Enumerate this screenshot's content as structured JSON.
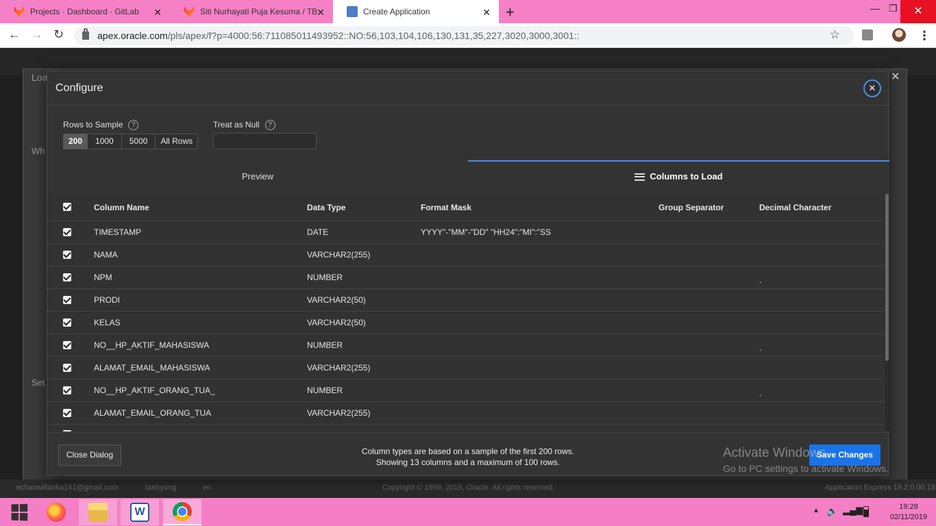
{
  "browser": {
    "tabs": [
      {
        "title": "Projects · Dashboard · GitLab"
      },
      {
        "title": "Siti Nurhayati Puja Kesuma / TB D"
      },
      {
        "title": "Create Application"
      }
    ],
    "url_host": "apex.oracle.com",
    "url_path": "/pls/apex/f?p=4000:56:711085011493952::NO:56,103,104,106,130,131,35,227,3020,3000,3001::"
  },
  "background": {
    "dialog_title_partial": "Loa",
    "section1_partial": "Wh",
    "section2_partial": "Set",
    "footer_email": "echaowillanka141@gmail.com",
    "footer_user": "taehyung",
    "footer_lang": "en",
    "footer_copyright": "Copyright © 1999, 2019, Oracle. All rights reserved.",
    "footer_version": "Application Express 19.2.0.00.18"
  },
  "dialog": {
    "title": "Configure",
    "rows_to_sample_label": "Rows to Sample",
    "rows_options": [
      "200",
      "1000",
      "5000",
      "All Rows"
    ],
    "rows_selected": "200",
    "treat_as_null_label": "Treat as Null",
    "treat_as_null_value": "",
    "tabs": {
      "preview": "Preview",
      "columns": "Columns to Load"
    },
    "headers": {
      "column_name": "Column Name",
      "data_type": "Data Type",
      "format_mask": "Format Mask",
      "group_separator": "Group Separator",
      "decimal_character": "Decimal Character"
    },
    "rows": [
      {
        "name": "TIMESTAMP",
        "type": "DATE",
        "mask": "YYYY\"-\"MM\"-\"DD\" \"HH24\":\"MI\":\"SS",
        "group": "",
        "decimal": ""
      },
      {
        "name": "NAMA",
        "type": "VARCHAR2(255)",
        "mask": "",
        "group": "",
        "decimal": ""
      },
      {
        "name": "NPM",
        "type": "NUMBER",
        "mask": "",
        "group": "",
        "decimal": "."
      },
      {
        "name": "PRODI",
        "type": "VARCHAR2(50)",
        "mask": "",
        "group": "",
        "decimal": ""
      },
      {
        "name": "KELAS",
        "type": "VARCHAR2(50)",
        "mask": "",
        "group": "",
        "decimal": ""
      },
      {
        "name": "NO__HP_AKTIF_MAHASISWA",
        "type": "NUMBER",
        "mask": "",
        "group": "",
        "decimal": "."
      },
      {
        "name": "ALAMAT_EMAIL_MAHASISWA",
        "type": "VARCHAR2(255)",
        "mask": "",
        "group": "",
        "decimal": ""
      },
      {
        "name": "NO__HP_AKTIF_ORANG_TUA_",
        "type": "NUMBER",
        "mask": "",
        "group": "",
        "decimal": "."
      },
      {
        "name": "ALAMAT_EMAIL_ORANG_TUA",
        "type": "VARCHAR2(255)",
        "mask": "",
        "group": "",
        "decimal": ""
      }
    ],
    "footer_msg_line1": "Column types are based on a sample of the first 200 rows.",
    "footer_msg_line2": "Showing 13 columns and a maximum of 100 rows.",
    "close_button": "Close Dialog",
    "save_button": "Save Changes"
  },
  "watermark": {
    "line1": "Activate Windows",
    "line2": "Go to PC settings to activate Windows."
  },
  "taskbar": {
    "time": "19:28",
    "date": "02/11/2019"
  },
  "colors": {
    "accent": "#1a73e8",
    "tab_strip": "#f580c6",
    "dialog_bg": "#333334"
  }
}
